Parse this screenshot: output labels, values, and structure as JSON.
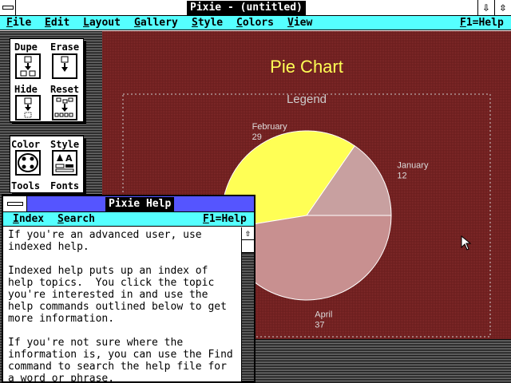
{
  "app": {
    "title": "Pixie - (untitled)",
    "min_glyph": "⇩",
    "max_glyph": "⇳"
  },
  "menubar": {
    "items": [
      "File",
      "Edit",
      "Layout",
      "Gallery",
      "Style",
      "Colors",
      "View"
    ],
    "help": "F1=Help"
  },
  "toolbox": {
    "dupe": "Dupe",
    "erase": "Erase",
    "hide": "Hide",
    "reset": "Reset",
    "color": "Color",
    "style": "Style",
    "tools": "Tools",
    "fonts": "Fonts"
  },
  "chart_data": {
    "type": "pie",
    "title": "Pie Chart",
    "legend_label": "Legend",
    "slices": [
      {
        "label": "January",
        "value": 12,
        "color": "#c8a0a0"
      },
      {
        "label": "February",
        "value": 29,
        "color": "#ffff55"
      },
      {
        "label": "April",
        "value": 37,
        "color": "#c89090"
      }
    ]
  },
  "colors": {
    "cyan": "#55ffff",
    "blue": "#5555ff",
    "chart_bg": "#6b1e1e",
    "title_yellow": "#ffff55"
  },
  "help": {
    "title": "Pixie Help",
    "menu": [
      "Index",
      "Search"
    ],
    "f1": "F1=Help",
    "scroll_up": "⇧",
    "text": "If you're an advanced user, use\nindexed help.\n\nIndexed help puts up an index of\nhelp topics.  You click the topic\nyou're interested in and use the\nhelp commands outlined below to get\nmore information.\n\nIf you're not sure where the\ninformation is, you can use the Find\ncommand to search the help file for\na word or phrase."
  }
}
